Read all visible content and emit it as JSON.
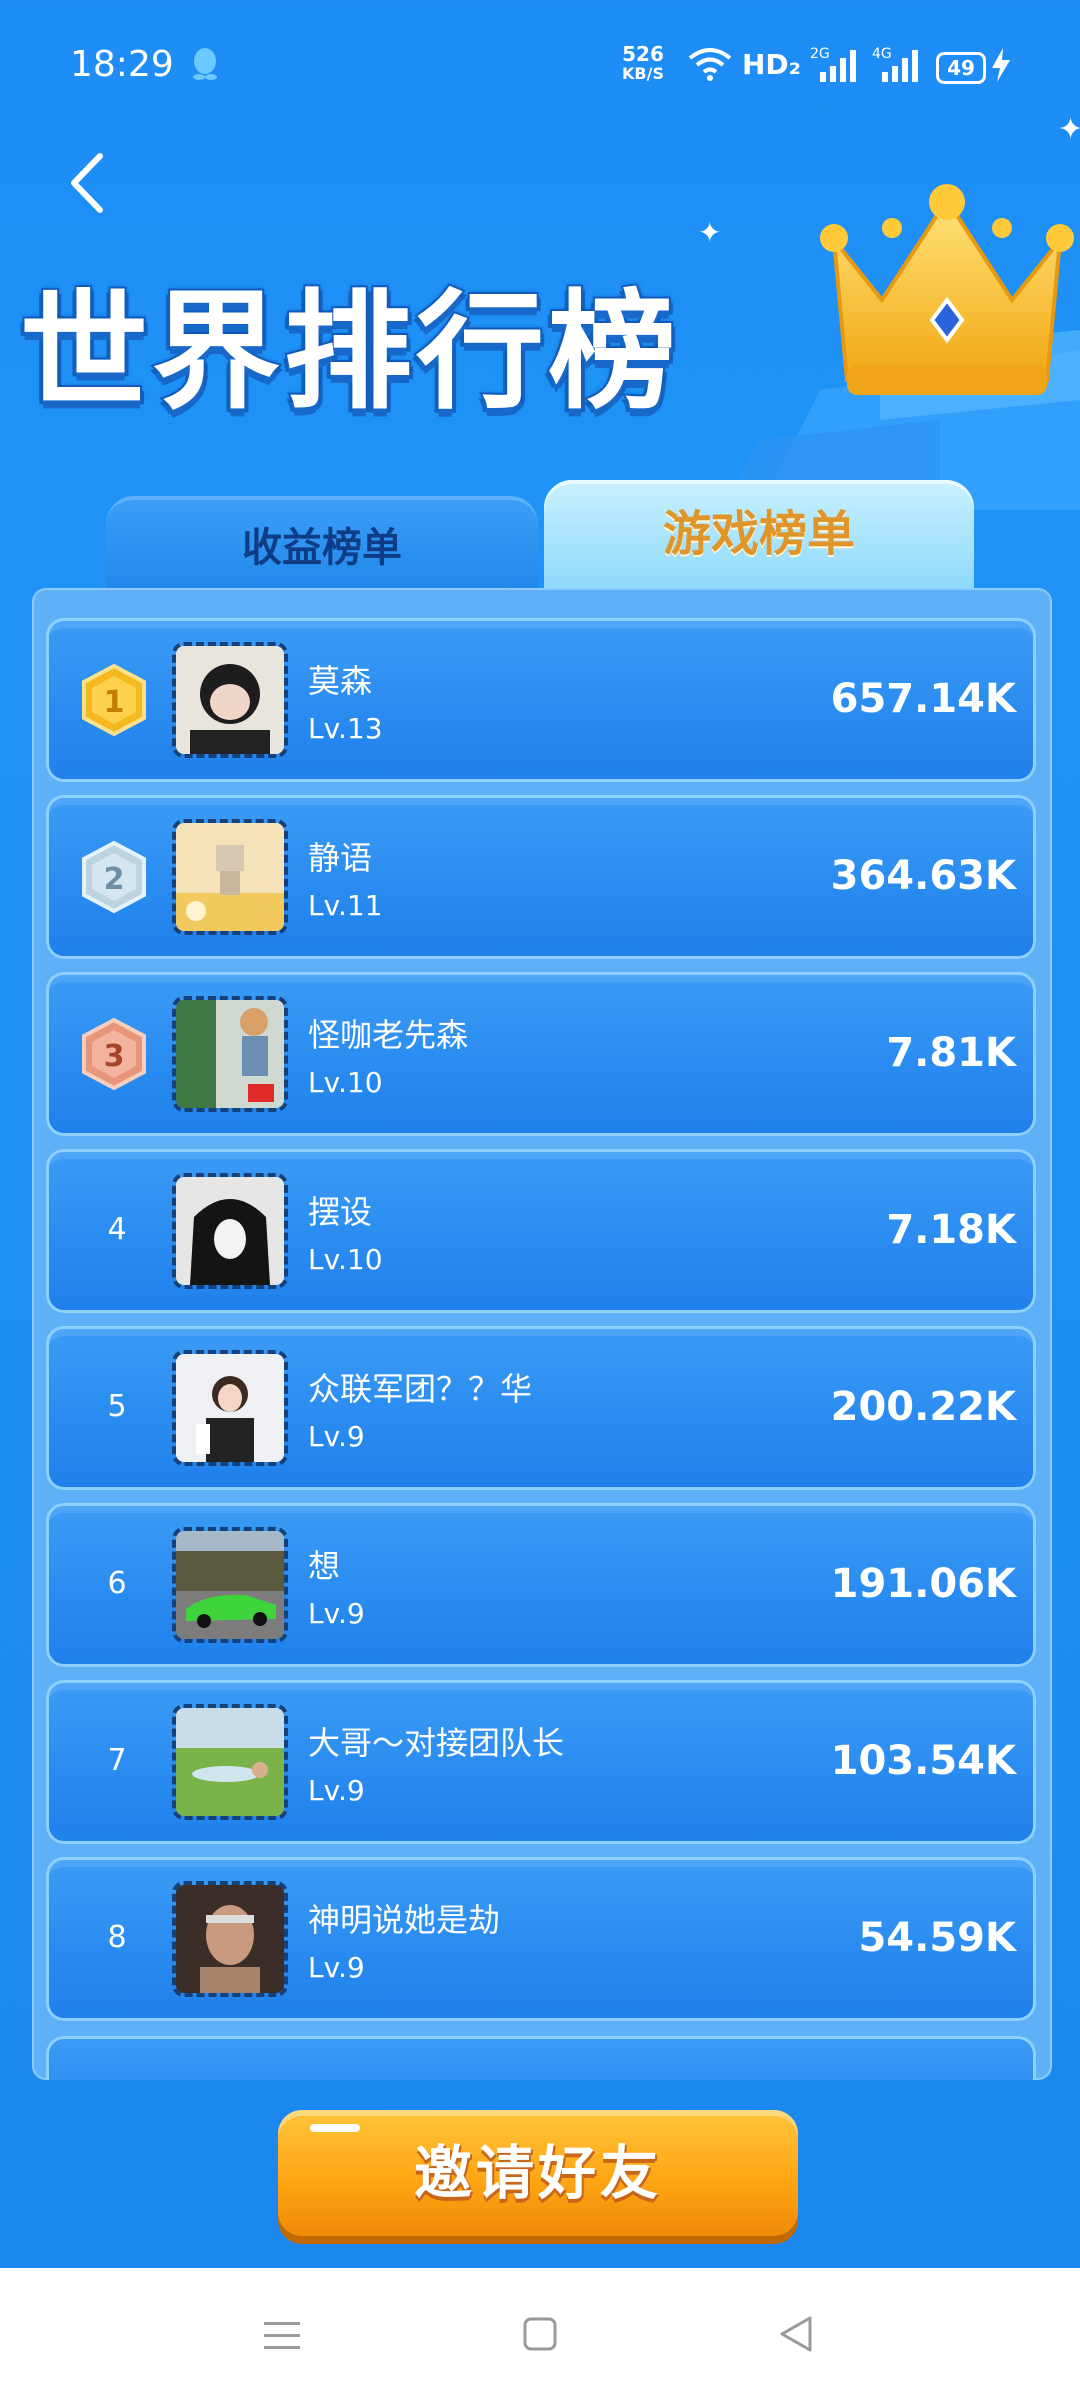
{
  "status_bar": {
    "time": "18:29",
    "net_speed_value": "526",
    "net_speed_unit": "KB/S",
    "hd_label": "HD₂",
    "sim1_label": "2G",
    "sim2_label": "4G",
    "battery": "49"
  },
  "header": {
    "title": "世界排行榜"
  },
  "tabs": [
    {
      "label": "收益榜单",
      "active": false
    },
    {
      "label": "游戏榜单",
      "active": true
    }
  ],
  "leaderboard": [
    {
      "rank": "1",
      "name": "莫森",
      "level": "Lv.13",
      "score": "657.14K"
    },
    {
      "rank": "2",
      "name": "静语",
      "level": "Lv.11",
      "score": "364.63K"
    },
    {
      "rank": "3",
      "name": "怪咖老先森",
      "level": "Lv.10",
      "score": "7.81K"
    },
    {
      "rank": "4",
      "name": "摆设",
      "level": "Lv.10",
      "score": "7.18K"
    },
    {
      "rank": "5",
      "name": "众联军团？？华",
      "level": "Lv.9",
      "score": "200.22K"
    },
    {
      "rank": "6",
      "name": "想",
      "level": "Lv.9",
      "score": "191.06K"
    },
    {
      "rank": "7",
      "name": "大哥～对接团队长",
      "level": "Lv.9",
      "score": "103.54K"
    },
    {
      "rank": "8",
      "name": "神明说她是劫",
      "level": "Lv.9",
      "score": "54.59K"
    }
  ],
  "invite_button": {
    "label": "邀请好友"
  },
  "colors": {
    "background": "#1e8cf5",
    "gold_medal": "#f5b821",
    "silver_medal": "#a9c6d8",
    "bronze_medal": "#e08a6c",
    "invite_orange": "#ffa615"
  }
}
